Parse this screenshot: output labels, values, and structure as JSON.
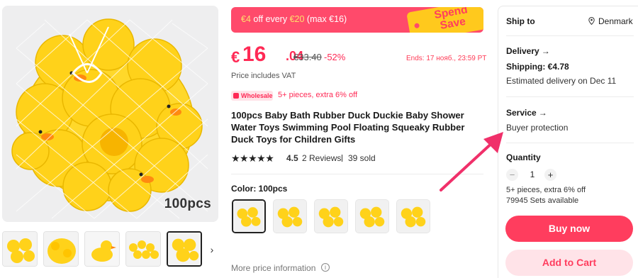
{
  "gallery": {
    "main_caption": "100pcs",
    "thumb_count": 5,
    "selected_thumb": 5
  },
  "promo": {
    "text_prefix": "€4",
    "text_mid": " off every ",
    "text_amount": "€20",
    "text_suffix": " (max €16)",
    "tag_line1": "Spend",
    "tag_line2": "Save"
  },
  "price": {
    "currency": "€",
    "integer": "16",
    "decimal": ".04",
    "old": "€33.40",
    "discount": "-52%",
    "ends": "Ends: 17 нояб., 23:59 PT",
    "vat_note": "Price includes VAT"
  },
  "wholesale": {
    "badge": "Wholesale",
    "text": "5+ pieces, extra 6% off"
  },
  "product": {
    "title": "100pcs Baby Bath Rubber Duck Duckie Baby Shower Water Toys Swimming Pool Floating Squeaky Rubber Duck Toys for Children Gifts",
    "stars": "★★★★★",
    "rating": "4.5",
    "reviews": "2 Reviews",
    "sold": "39 sold",
    "rating_value": 4.5
  },
  "color": {
    "label": "Color: 100pcs",
    "swatch_count": 5,
    "selected_swatch": 1
  },
  "more_price": "More price information",
  "panel": {
    "ship_to_label": "Ship to",
    "ship_to_country": "Denmark",
    "delivery_title": "Delivery",
    "shipping_cost": "Shipping: €4.78",
    "estimated": "Estimated delivery on Dec 11",
    "service_title": "Service",
    "service_value": "Buyer protection",
    "quantity_title": "Quantity",
    "quantity_value": "1",
    "minus": "−",
    "plus": "+",
    "qty_note": "5+ pieces, extra 6% off",
    "available": "79945 Sets available",
    "buy_now": "Buy now",
    "add_to_cart": "Add to Cart",
    "arrow_glyph": "→"
  },
  "colors": {
    "accent": "#ff2a55",
    "button": "#ff3d5e",
    "button_light": "#ffe3e8",
    "tag": "#ffc91d",
    "annotation": "#f0306a",
    "duck": "#ffd21a"
  }
}
